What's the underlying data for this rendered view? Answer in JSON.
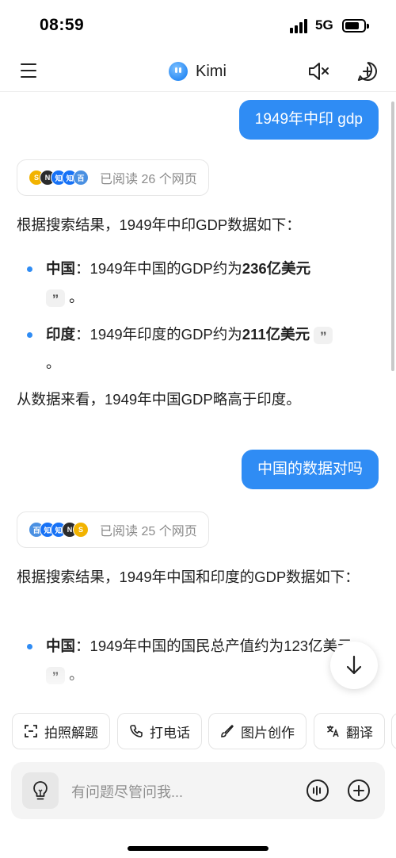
{
  "status_bar": {
    "time": "08:59",
    "network": "5G"
  },
  "header": {
    "app_name": "Kimi"
  },
  "conversation": {
    "q1": {
      "text": "1949年中印 gdp"
    },
    "r1": {
      "read_label": "已阅读 26 个网页",
      "intro": "根据搜索结果，1949年中印GDP数据如下：",
      "bullets": [
        {
          "label": "中国",
          "sep": "：",
          "text": "1949年中国的GDP约为",
          "value": "236亿美元",
          "end": "。"
        },
        {
          "label": "印度",
          "sep": "：",
          "text": "1949年印度的GDP约为",
          "value": "211亿美元",
          "end": "。"
        }
      ],
      "conclusion": "从数据来看，1949年中国GDP略高于印度。"
    },
    "q2": {
      "text": "中国的数据对吗"
    },
    "r2": {
      "read_label": "已阅读 25 个网页",
      "intro": "根据搜索结果，1949年中国和印度的GDP数据如下：",
      "bullets": [
        {
          "label": "中国",
          "sep": "：",
          "text": "1949年中国的国民总产值约为123亿美元",
          "end": "。"
        }
      ]
    },
    "quote_glyph": "”"
  },
  "quick_actions": [
    {
      "label": "拍照解题",
      "icon": "scan-icon"
    },
    {
      "label": "打电话",
      "icon": "phone-icon"
    },
    {
      "label": "图片创作",
      "icon": "brush-icon"
    },
    {
      "label": "翻译",
      "icon": "translate-icon"
    }
  ],
  "input": {
    "placeholder": "有问题尽管问我..."
  },
  "colors": {
    "accent": "#2f8cf4",
    "user_bubble": "#2f8cf4",
    "muted_text": "#8a8a8a"
  }
}
